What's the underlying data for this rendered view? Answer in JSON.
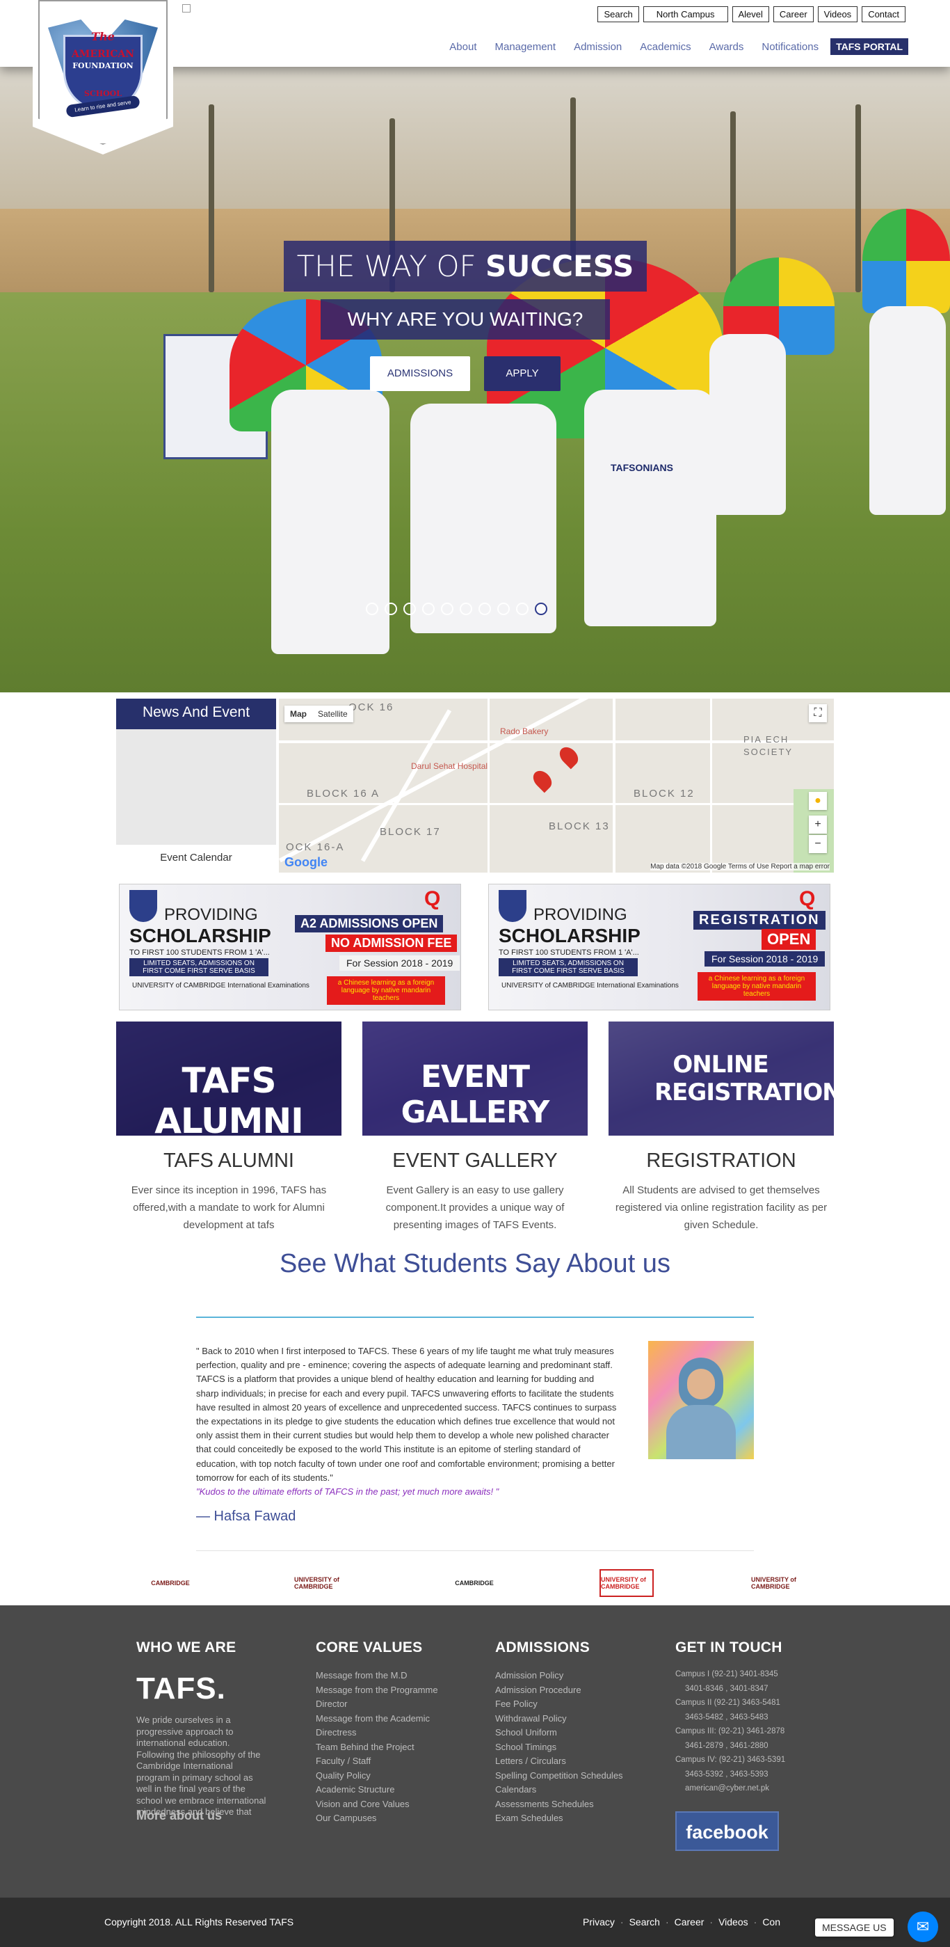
{
  "header": {
    "logo": {
      "line1": "The",
      "line2": "AMERICAN",
      "line3": "FOUNDATION",
      "line4": "SCHOOL",
      "motto": "Learn to rise and serve"
    },
    "top_links": [
      "Search",
      "North Campus",
      "Alevel",
      "Career",
      "Videos",
      "Contact"
    ],
    "nav": [
      "About",
      "Management",
      "Admission",
      "Academics",
      "Awards",
      "Notifications"
    ],
    "portal": "TAFS PORTAL"
  },
  "hero": {
    "title_light": "THE WAY OF ",
    "title_bold": "SUCCESS",
    "subtitle": "WHY ARE YOU WAITING?",
    "btn_admissions": "ADMISSIONS",
    "btn_apply": "APPLY",
    "slide_count": 10,
    "active_slide": 10,
    "shirt_text": "TAFSONIANS"
  },
  "news": {
    "heading": "News And Event",
    "calendar": "Event Calendar"
  },
  "map": {
    "type_map": "Map",
    "type_satellite": "Satellite",
    "labels": [
      "OCK 16",
      "BLOCK 16 A",
      "BLOCK 17",
      "BLOCK 13",
      "BLOCK 12",
      "PIA ECH SOCIETY",
      "OCK 16-A",
      "Darul Sehat Hospital",
      "Rado Bakery"
    ],
    "logo": "Google",
    "footer": "Map data ©2018 Google   Terms of Use   Report a map error"
  },
  "banners": [
    {
      "providing": "PROVIDING",
      "scholarship": "SCHOLARSHIP",
      "first100": "TO FIRST 100 STUDENTS FROM 1 'A'...",
      "limited": "LIMITED SEATS, ADMISSIONS ON FIRST COME FIRST SERVE BASIS",
      "cambridge": "UNIVERSITY of CAMBRIDGE International Examinations",
      "line1": "A2 ADMISSIONS OPEN",
      "line2": "NO ADMISSION FEE",
      "session": "For Session 2018 - 2019",
      "chinese": "a Chinese learning as a foreign language by native mandarin teachers"
    },
    {
      "providing": "PROVIDING",
      "scholarship": "SCHOLARSHIP",
      "first100": "TO FIRST 100 STUDENTS FROM 1 'A'...",
      "limited": "LIMITED SEATS, ADMISSIONS ON FIRST COME FIRST SERVE BASIS",
      "cambridge": "UNIVERSITY of CAMBRIDGE International Examinations",
      "line1": "REGISTRATION",
      "line2": "OPEN",
      "session": "For Session 2018 - 2019",
      "chinese": "a Chinese learning as a foreign language by native mandarin teachers"
    }
  ],
  "tiles": [
    {
      "overlay": "TAFS ALUMNI",
      "title": "TAFS ALUMNI",
      "text": "Ever since its inception in 1996, TAFS has offered,with a mandate to work for Alumni development at tafs"
    },
    {
      "overlay": "EVENT GALLERY",
      "title": "EVENT GALLERY",
      "text": "Event Gallery is an easy to use gallery component.It provides a unique way of presenting images of TAFS Events."
    },
    {
      "overlay": "ONLINE REGISTRATION",
      "title": "REGISTRATION",
      "text": "All Students are advised to get themselves registered via online registration facility as per given Schedule."
    }
  ],
  "testimonial": {
    "heading": "See What Students Say About us",
    "quote": "\" Back to 2010 when I first interposed to TAFCS. These 6 years of my life taught me what truly measures perfection, quality and pre - eminence; covering the aspects of adequate learning and predominant staff. TAFCS is a platform that provides a unique blend of healthy education and learning for budding and sharp individuals; in precise for each and every pupil. TAFCS unwavering efforts to facilitate the students have resulted in almost 20 years of excellence and unprecedented success. TAFCS continues to surpass the expectations in its pledge to give students the education which defines true excellence that would not only assist them in their current studies but would help them to develop a whole new polished character that could conceitedly be exposed to the world This institute is an epitome of sterling standard of education, with top notch faculty of town under one roof and comfortable environment; promising a better tomorrow for each of its students.\"",
    "kudos": "\"Kudos to the ultimate efforts of TAFCS in the past; yet much more awaits! \"",
    "author": "— Hafsa Fawad"
  },
  "partners": [
    "CAMBRIDGE",
    "UNIVERSITY of CAMBRIDGE",
    "CAMBRIDGE",
    "UNIVERSITY of CAMBRIDGE",
    "UNIVERSITY of CAMBRIDGE"
  ],
  "footer": {
    "who": {
      "heading": "WHO WE ARE",
      "brand": "TAFS.",
      "text": "We pride ourselves in a progressive approach to international education. Following the philosophy of the Cambridge International program in primary school as well in the final years of the school we embrace international mindedness and believe that",
      "more": "More about us"
    },
    "core": {
      "heading": "CORE VALUES",
      "items": [
        "Message from the M.D",
        "Message from the Programme Director",
        "Message from the Academic Directress",
        "Team Behind the Project",
        "Faculty / Staff",
        "Quality Policy",
        "Academic Structure",
        "Vision and Core Values",
        "Our Campuses"
      ]
    },
    "admissions": {
      "heading": "ADMISSIONS",
      "items": [
        "Admission Policy",
        "Admission Procedure",
        "Fee Policy",
        "Withdrawal Policy",
        "School Uniform",
        "School Timings",
        "Letters / Circulars",
        "Spelling Competition Schedules",
        "Calendars",
        "Assessments Schedules",
        "Exam Schedules"
      ]
    },
    "contact": {
      "heading": "GET IN TOUCH",
      "items": [
        "Campus I (92-21) 3401-8345",
        "3401-8346 , 3401-8347",
        "Campus II (92-21) 3463-5481",
        "3463-5482 , 3463-5483",
        "Campus III: (92-21) 3461-2878",
        "3461-2879 , 3461-2880",
        "Campus IV: (92-21) 3463-5391",
        "3463-5392 , 3463-5393",
        "american@cyber.net.pk"
      ],
      "facebook": "facebook"
    }
  },
  "bottom": {
    "copyright": "Copyright 2018. ALL Rights Reserved TAFS",
    "links": [
      "Privacy",
      "Search",
      "Career",
      "Videos",
      "Con"
    ],
    "message_us": "MESSAGE US"
  },
  "colors": {
    "brand_navy": "#27306b",
    "accent_blue": "#3e4e96",
    "footer_bg": "#4a4a4a",
    "bottom_bg": "#2e2e2e",
    "facebook": "#3b5998"
  }
}
